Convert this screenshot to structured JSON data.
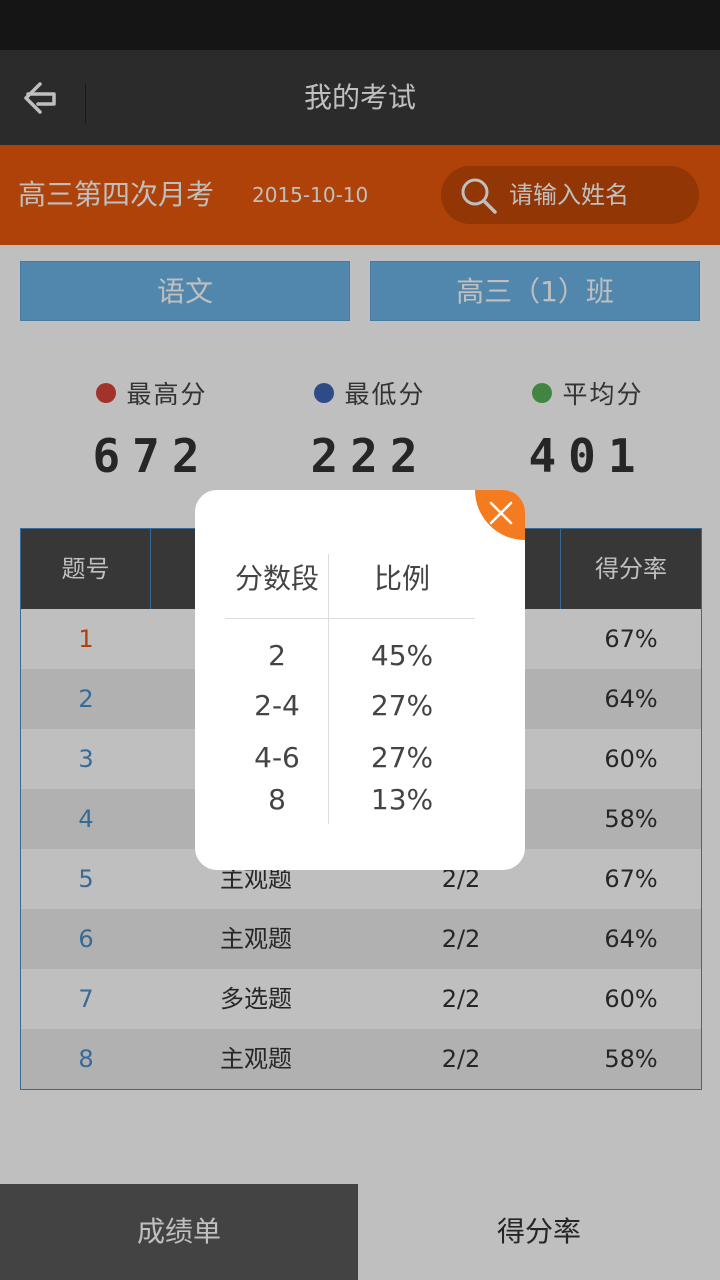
{
  "nav": {
    "title": "我的考试"
  },
  "exam": {
    "name": "高三第四次月考",
    "date": "2015-10-10",
    "search_placeholder": "请输入姓名"
  },
  "filters": {
    "subject": "语文",
    "class": "高三（1）班"
  },
  "stats": [
    {
      "label": "最高分",
      "value": "672",
      "color": "#d9443a"
    },
    {
      "label": "最低分",
      "value": "222",
      "color": "#3d64b5"
    },
    {
      "label": "平均分",
      "value": "401",
      "color": "#59b25a"
    }
  ],
  "table": {
    "headers": [
      "题号",
      "",
      "",
      "得分率"
    ],
    "rows": [
      {
        "num": "1",
        "type": "",
        "score": "",
        "rate": "67%"
      },
      {
        "num": "2",
        "type": "",
        "score": "",
        "rate": "64%"
      },
      {
        "num": "3",
        "type": "",
        "score": "",
        "rate": "60%"
      },
      {
        "num": "4",
        "type": "",
        "score": "",
        "rate": "58%"
      },
      {
        "num": "5",
        "type": "主观题",
        "score": "2/2",
        "rate": "67%"
      },
      {
        "num": "6",
        "type": "主观题",
        "score": "2/2",
        "rate": "64%"
      },
      {
        "num": "7",
        "type": "多选题",
        "score": "2/2",
        "rate": "60%"
      },
      {
        "num": "8",
        "type": "主观题",
        "score": "2/2",
        "rate": "58%"
      }
    ]
  },
  "modal": {
    "col1": "分数段",
    "col2": "比例",
    "rows": [
      {
        "range": "2",
        "ratio": "45%"
      },
      {
        "range": "2-4",
        "ratio": "27%"
      },
      {
        "range": "4-6",
        "ratio": "27%"
      },
      {
        "range": "8",
        "ratio": "13%"
      }
    ]
  },
  "tabs": {
    "scores": "成绩单",
    "rate": "得分率"
  }
}
